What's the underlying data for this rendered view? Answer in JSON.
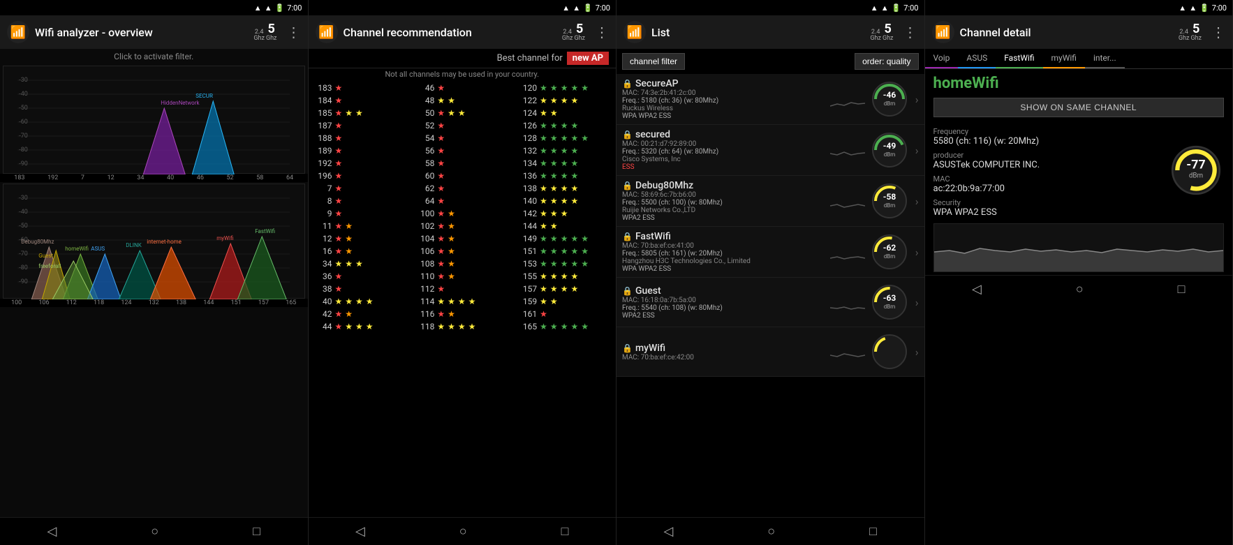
{
  "screen1": {
    "title": "Wifi analyzer - overview",
    "filter_hint": "Click to activate filter.",
    "freq_small1": "2.4",
    "freq_large1": "5",
    "freq_unit1": "Ghz",
    "freq_unit2": "Ghz",
    "status_time": "7:00",
    "graph1": {
      "y_labels": [
        "-30",
        "-40",
        "-50",
        "-60",
        "-70",
        "-80",
        "-90"
      ],
      "x_labels": [
        "183",
        "192",
        "7",
        "12",
        "34",
        "40",
        "46",
        "52",
        "58",
        "64"
      ],
      "networks": [
        "HiddenNetwork",
        "SECUR"
      ]
    },
    "graph2": {
      "y_labels": [
        "-30",
        "-40",
        "-50",
        "-60",
        "-70",
        "-80",
        "-90"
      ],
      "x_labels": [
        "100",
        "106",
        "112",
        "118",
        "124",
        "132",
        "138",
        "144",
        "151",
        "157",
        "165"
      ],
      "networks": [
        "Debug80Mhz",
        "Guest",
        "homeWifi",
        "ASUS",
        "freeforall",
        "DLINK",
        "internet-home",
        "myWifi",
        "FastWifi"
      ]
    }
  },
  "screen2": {
    "title": "Channel recommendation",
    "freq_small1": "2.4",
    "freq_large1": "5",
    "freq_unit1": "Ghz",
    "freq_unit2": "Ghz",
    "status_time": "7:00",
    "best_channel_label": "Best channel for",
    "new_ap_label": "new AP",
    "warning": "Not all channels may be used in your country.",
    "channels": [
      {
        "ch": "183",
        "stars": [
          0,
          0,
          0,
          0,
          0
        ]
      },
      {
        "ch": "184",
        "stars": [
          0,
          0,
          0,
          0,
          0
        ]
      },
      {
        "ch": "185",
        "stars": [
          2,
          2,
          0,
          0,
          0
        ]
      },
      {
        "ch": "187",
        "stars": [
          0,
          0,
          0,
          0,
          0
        ]
      },
      {
        "ch": "188",
        "stars": [
          0,
          0,
          0,
          0,
          0
        ]
      },
      {
        "ch": "189",
        "stars": [
          0,
          0,
          0,
          0,
          0
        ]
      },
      {
        "ch": "192",
        "stars": [
          0,
          0,
          0,
          0,
          0
        ]
      },
      {
        "ch": "196",
        "stars": [
          0,
          0,
          0,
          0,
          0
        ]
      },
      {
        "ch": "7",
        "stars": [
          0,
          0,
          0,
          0,
          0
        ]
      },
      {
        "ch": "8",
        "stars": [
          0,
          0,
          0,
          0,
          0
        ]
      },
      {
        "ch": "9",
        "stars": [
          0,
          0,
          0,
          0,
          0
        ]
      },
      {
        "ch": "11",
        "stars": [
          2,
          0,
          0,
          0,
          0
        ]
      },
      {
        "ch": "12",
        "stars": [
          2,
          0,
          0,
          0,
          0
        ]
      },
      {
        "ch": "16",
        "stars": [
          2,
          0,
          0,
          0,
          0
        ]
      },
      {
        "ch": "34",
        "stars": [
          2,
          2,
          2,
          0,
          0
        ]
      },
      {
        "ch": "36",
        "stars": [
          2,
          2,
          0,
          0,
          0
        ]
      },
      {
        "ch": "38",
        "stars": [
          0,
          0,
          0,
          0,
          0
        ]
      },
      {
        "ch": "40",
        "stars": [
          2,
          2,
          2,
          2,
          0
        ]
      },
      {
        "ch": "42",
        "stars": [
          2,
          2,
          0,
          0,
          0
        ]
      },
      {
        "ch": "44",
        "stars": [
          2,
          2,
          2,
          2,
          0
        ]
      }
    ],
    "channels2": [
      {
        "ch": "46",
        "stars": [
          0,
          0,
          0,
          0,
          0
        ]
      },
      {
        "ch": "48",
        "stars": [
          2,
          2,
          0,
          0,
          0
        ]
      },
      {
        "ch": "50",
        "stars": [
          2,
          2,
          0,
          0,
          0
        ]
      },
      {
        "ch": "52",
        "stars": [
          0,
          0,
          0,
          0,
          0
        ]
      },
      {
        "ch": "54",
        "stars": [
          0,
          0,
          0,
          0,
          0
        ]
      },
      {
        "ch": "56",
        "stars": [
          0,
          0,
          0,
          0,
          0
        ]
      },
      {
        "ch": "58",
        "stars": [
          0,
          0,
          0,
          0,
          0
        ]
      },
      {
        "ch": "60",
        "stars": [
          0,
          0,
          0,
          0,
          0
        ]
      },
      {
        "ch": "62",
        "stars": [
          0,
          0,
          0,
          0,
          0
        ]
      },
      {
        "ch": "64",
        "stars": [
          0,
          0,
          0,
          0,
          0
        ]
      },
      {
        "ch": "100",
        "stars": [
          2,
          0,
          0,
          0,
          0
        ]
      },
      {
        "ch": "102",
        "stars": [
          2,
          0,
          0,
          0,
          0
        ]
      },
      {
        "ch": "104",
        "stars": [
          2,
          0,
          0,
          0,
          0
        ]
      },
      {
        "ch": "106",
        "stars": [
          2,
          0,
          0,
          0,
          0
        ]
      },
      {
        "ch": "108",
        "stars": [
          2,
          0,
          0,
          0,
          0
        ]
      },
      {
        "ch": "110",
        "stars": [
          2,
          2,
          0,
          0,
          0
        ]
      },
      {
        "ch": "112",
        "stars": [
          0,
          0,
          0,
          0,
          0
        ]
      },
      {
        "ch": "114",
        "stars": [
          2,
          2,
          2,
          2,
          0
        ]
      },
      {
        "ch": "116",
        "stars": [
          2,
          2,
          0,
          0,
          0
        ]
      },
      {
        "ch": "118",
        "stars": [
          2,
          2,
          2,
          2,
          0
        ]
      }
    ],
    "channels3": [
      {
        "ch": "120",
        "stars": [
          3,
          3,
          3,
          3,
          3
        ]
      },
      {
        "ch": "122",
        "stars": [
          2,
          2,
          2,
          2,
          0
        ]
      },
      {
        "ch": "124",
        "stars": [
          2,
          2,
          0,
          0,
          0
        ]
      },
      {
        "ch": "126",
        "stars": [
          3,
          3,
          3,
          3,
          0
        ]
      },
      {
        "ch": "128",
        "stars": [
          3,
          3,
          3,
          3,
          3
        ]
      },
      {
        "ch": "132",
        "stars": [
          3,
          3,
          3,
          3,
          0
        ]
      },
      {
        "ch": "134",
        "stars": [
          3,
          3,
          3,
          3,
          0
        ]
      },
      {
        "ch": "136",
        "stars": [
          3,
          3,
          3,
          3,
          0
        ]
      },
      {
        "ch": "138",
        "stars": [
          2,
          2,
          2,
          2,
          0
        ]
      },
      {
        "ch": "140",
        "stars": [
          2,
          2,
          2,
          2,
          0
        ]
      },
      {
        "ch": "142",
        "stars": [
          2,
          2,
          2,
          0,
          0
        ]
      },
      {
        "ch": "144",
        "stars": [
          2,
          2,
          0,
          0,
          0
        ]
      },
      {
        "ch": "149",
        "stars": [
          3,
          3,
          3,
          3,
          3
        ]
      },
      {
        "ch": "151",
        "stars": [
          3,
          3,
          3,
          3,
          3
        ]
      },
      {
        "ch": "153",
        "stars": [
          3,
          3,
          3,
          3,
          3
        ]
      },
      {
        "ch": "155",
        "stars": [
          2,
          2,
          2,
          2,
          0
        ]
      },
      {
        "ch": "157",
        "stars": [
          2,
          2,
          2,
          2,
          0
        ]
      },
      {
        "ch": "159",
        "stars": [
          2,
          2,
          0,
          0,
          0
        ]
      },
      {
        "ch": "161",
        "stars": [
          0,
          0,
          0,
          0,
          0
        ]
      },
      {
        "ch": "165",
        "stars": [
          3,
          3,
          3,
          3,
          3
        ]
      }
    ]
  },
  "screen3": {
    "title": "List",
    "freq_small1": "2.4",
    "freq_large1": "5",
    "freq_unit1": "Ghz",
    "freq_unit2": "Ghz",
    "status_time": "7:00",
    "filter_btn": "channel filter",
    "order_btn": "order: quality",
    "networks": [
      {
        "name": "SecureAP",
        "mac": "MAC: 74:3e:2b:41:2c:00",
        "freq": "Freq.: 5180 (ch: 36) (w: 80Mhz)",
        "maker": "Ruckus Wireless",
        "security": "WPA WPA2 ESS",
        "dbm": "-46",
        "sec_color": "#888"
      },
      {
        "name": "secured",
        "mac": "MAC: 00:21:d7:92:89:00",
        "freq": "Freq.: 5320 (ch: 64) (w: 80Mhz)",
        "maker": "Cisco Systems, Inc",
        "security": "ESS",
        "dbm": "-49",
        "sec_color": "#f44"
      },
      {
        "name": "Debug80Mhz",
        "mac": "MAC: 58:69:6c:7b:b6:00",
        "freq": "Freq.: 5500 (ch: 100) (w: 80Mhz)",
        "maker": "Ruijie Networks Co.,LTD",
        "security": "WPA2 ESS",
        "dbm": "-58",
        "sec_color": "#888"
      },
      {
        "name": "FastWifi",
        "mac": "MAC: 70:ba:ef:ce:41:00",
        "freq": "Freq.: 5805 (ch: 161) (w: 20Mhz)",
        "maker": "Hangzhou H3C Technologies Co., Limited",
        "security": "WPA WPA2 ESS",
        "dbm": "-62",
        "sec_color": "#888"
      },
      {
        "name": "Guest",
        "mac": "MAC: 16:18:0a:7b:5a:00",
        "freq": "Freq.: 5540 (ch: 108) (w: 80Mhz)",
        "maker": "",
        "security": "WPA2 ESS",
        "dbm": "-63",
        "sec_color": "#888"
      },
      {
        "name": "myWifi",
        "mac": "MAC: 70:ba:ef:ce:42:00",
        "freq": "",
        "maker": "",
        "security": "",
        "dbm": "-",
        "sec_color": "#888"
      }
    ]
  },
  "screen4": {
    "title": "Channel detail",
    "freq_small1": "2.4",
    "freq_large1": "5",
    "freq_unit1": "Ghz",
    "freq_unit2": "Ghz",
    "status_time": "7:00",
    "tabs": [
      {
        "label": "Voip",
        "color": "#9c27b0"
      },
      {
        "label": "ASUS",
        "color": "#2196f3"
      },
      {
        "label": "FastWifi",
        "color": "#4caf50"
      },
      {
        "label": "myWifi",
        "color": "#ff9800"
      },
      {
        "label": "inter...",
        "color": "#555"
      }
    ],
    "network_name": "homeWifi",
    "show_same_channel_btn": "SHOW ON SAME CHANNEL",
    "freq_label": "Frequency",
    "freq_value": "5580 (ch: 116) (w: 20Mhz)",
    "producer_label": "producer",
    "producer_value": "ASUSTek COMPUTER INC.",
    "mac_label": "MAC",
    "mac_value": "ac:22:0b:9a:77:00",
    "security_label": "Security",
    "security_value": "WPA WPA2 ESS",
    "dbm_value": "-77",
    "dbm_unit": "dBm"
  },
  "nav": {
    "back": "◁",
    "home": "○",
    "recent": "□"
  }
}
